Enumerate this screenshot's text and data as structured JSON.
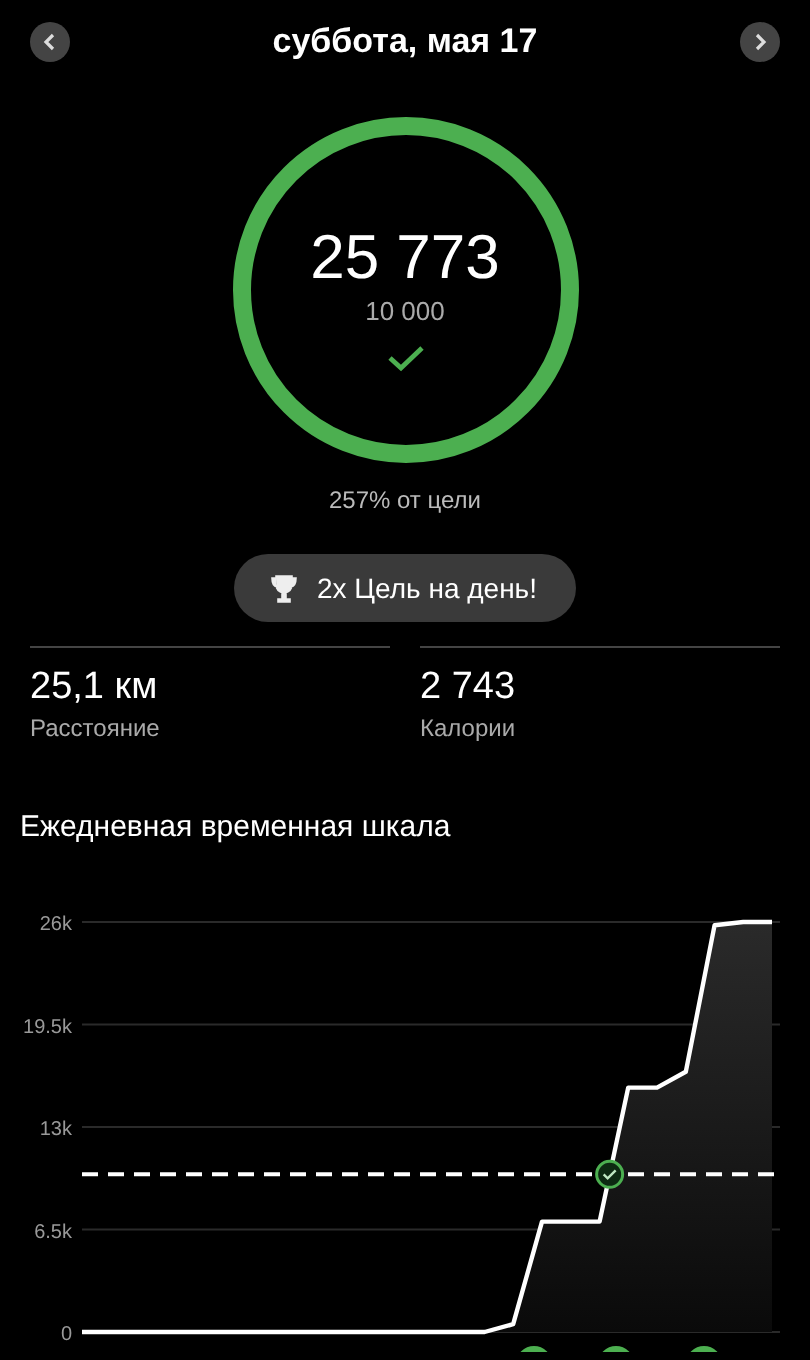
{
  "header": {
    "title": "суббота, мая 17"
  },
  "ring": {
    "steps": "25 773",
    "goal": "10 000",
    "level": 1,
    "percent": "257% от цели"
  },
  "badge": {
    "label": "2x Цель на день!"
  },
  "stats": [
    {
      "value": "25,1 км",
      "label": "Расстояние"
    },
    {
      "value": "2 743",
      "label": "Калории"
    }
  ],
  "timeline": {
    "title": "Ежедневная временная шкала",
    "chart_data": {
      "type": "area",
      "categories": [
        null,
        null,
        null,
        null,
        null,
        null,
        null,
        null,
        null,
        null,
        null,
        null,
        null,
        null,
        null,
        null,
        null,
        null,
        null,
        null,
        null,
        null,
        null,
        null,
        null
      ],
      "series": [
        {
          "color": "#ffffff",
          "values": [
            0,
            0,
            0,
            0,
            0,
            0,
            0,
            0,
            0,
            0,
            0,
            0,
            0,
            0,
            0,
            500,
            7000,
            7000,
            7000,
            15500,
            15500,
            16500,
            25800,
            26000,
            26000
          ]
        }
      ],
      "ylim": [
        0,
        26000
      ],
      "grid": true,
      "yticks": [
        {
          "value": 0,
          "label": "0"
        },
        {
          "value": 6500,
          "label": "6.5k"
        },
        {
          "value": 13000,
          "label": "13k"
        },
        {
          "value": 19500,
          "label": "19.5k"
        },
        {
          "value": 26000,
          "label": "26k"
        }
      ],
      "ref_lines": [
        {
          "axis": "y",
          "value": 10000
        }
      ]
    }
  }
}
